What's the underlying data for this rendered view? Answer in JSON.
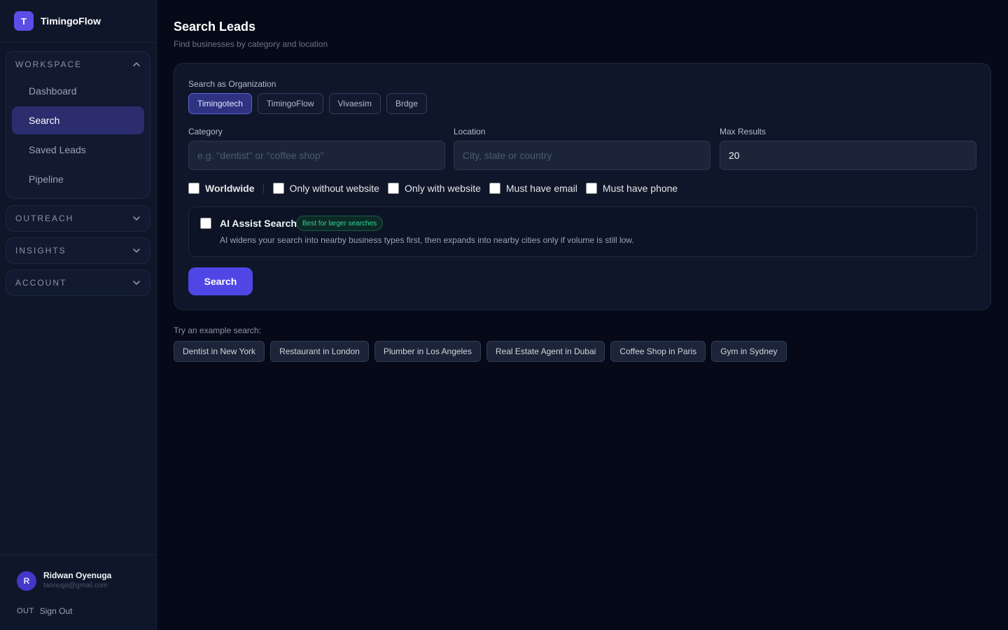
{
  "brand": {
    "logo_letter": "T",
    "name": "TimingoFlow"
  },
  "sidebar": {
    "groups": [
      {
        "title": "WORKSPACE",
        "expanded": true,
        "items": [
          {
            "label": "Dashboard",
            "active": false
          },
          {
            "label": "Search",
            "active": true
          },
          {
            "label": "Saved Leads",
            "active": false
          },
          {
            "label": "Pipeline",
            "active": false
          }
        ]
      },
      {
        "title": "OUTREACH",
        "expanded": false
      },
      {
        "title": "INSIGHTS",
        "expanded": false
      },
      {
        "title": "ACCOUNT",
        "expanded": false
      }
    ]
  },
  "user": {
    "initial": "R",
    "name": "Ridwan Oyenuga",
    "email": "taonuga@gmail.com",
    "signout_icon": "OUT",
    "signout_label": "Sign Out"
  },
  "header": {
    "title": "Search Leads",
    "subtitle": "Find businesses by category and location"
  },
  "form": {
    "org_label": "Search as Organization",
    "orgs": [
      {
        "label": "Timingotech",
        "selected": true
      },
      {
        "label": "TimingoFlow",
        "selected": false
      },
      {
        "label": "Vivaesim",
        "selected": false
      },
      {
        "label": "Brdge",
        "selected": false
      }
    ],
    "category": {
      "label": "Category",
      "value": "",
      "placeholder": "e.g. \"dentist\" or \"coffee shop\""
    },
    "location": {
      "label": "Location",
      "value": "",
      "placeholder": "City, state or country"
    },
    "max_results": {
      "label": "Max Results",
      "value": "20"
    },
    "checkboxes": [
      {
        "label": "Worldwide",
        "checked": false
      },
      {
        "label": "Only without website",
        "checked": false
      },
      {
        "label": "Only with website",
        "checked": false
      },
      {
        "label": "Must have email",
        "checked": false
      },
      {
        "label": "Must have phone",
        "checked": false
      }
    ],
    "ai_assist": {
      "title": "AI Assist Search",
      "badge": "Best for larger searches",
      "description": "AI widens your search into nearby business types first, then expands into nearby cities only if volume is still low.",
      "checked": false
    },
    "submit_label": "Search"
  },
  "examples": {
    "label": "Try an example search:",
    "items": [
      "Dentist in New York",
      "Restaurant in London",
      "Plumber in Los Angeles",
      "Real Estate Agent in Dubai",
      "Coffee Shop in Paris",
      "Gym in Sydney"
    ]
  },
  "colors": {
    "background": "#060a18",
    "sidebar": "#0f1629",
    "accent": "#4f46e5",
    "active_nav": "#2b2d6e",
    "badge_text": "#34d399"
  }
}
